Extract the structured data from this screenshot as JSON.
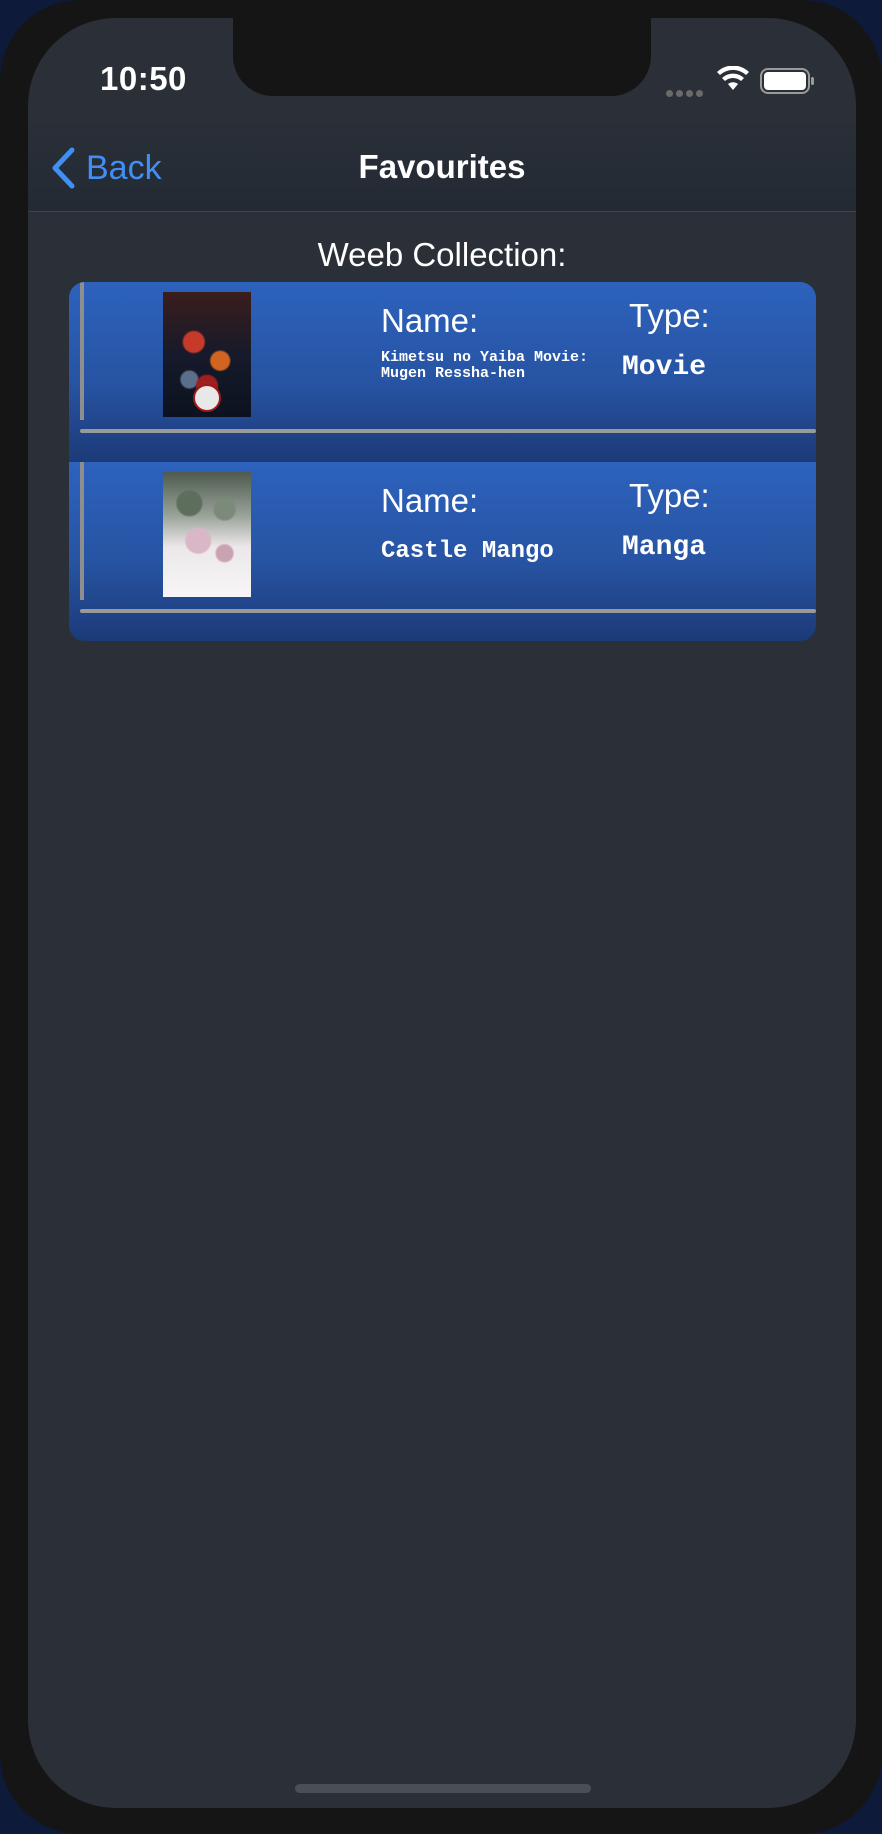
{
  "status_bar": {
    "time": "10:50",
    "icons": [
      "cellular-signal-icon",
      "wifi-icon",
      "battery-icon"
    ]
  },
  "nav": {
    "back_label": "Back",
    "title": "Favourites"
  },
  "collection": {
    "heading": "Weeb Collection:",
    "items": [
      {
        "name_label": "Name:",
        "name": "Kimetsu no Yaiba Movie: Mugen Ressha-hen",
        "type_label": "Type:",
        "type": "Movie",
        "poster": "movie-poster"
      },
      {
        "name_label": "Name:",
        "name": "Castle Mango",
        "type_label": "Type:",
        "type": "Manga",
        "poster": "manga-cover"
      }
    ]
  },
  "colors": {
    "accent": "#3f8ff5",
    "background": "#2b3038",
    "card": "#2754a3"
  }
}
